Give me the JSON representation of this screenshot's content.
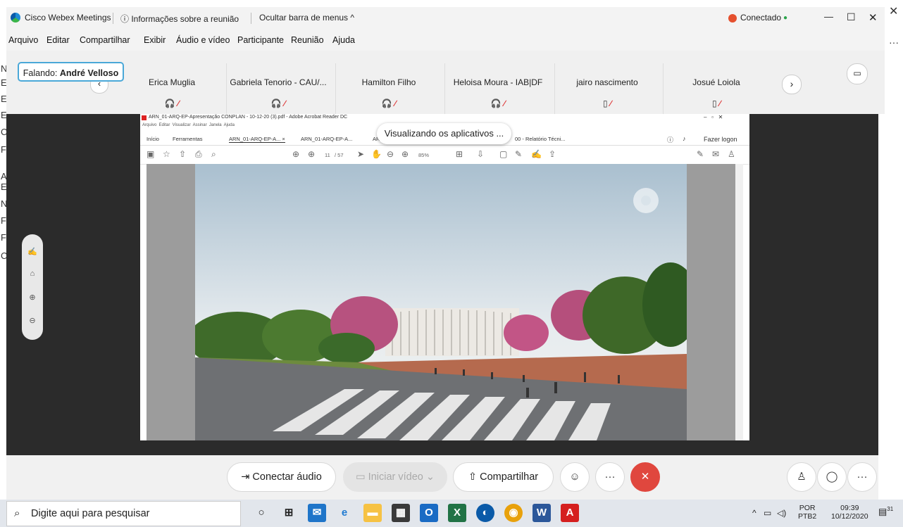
{
  "bg_letters": [
    "N",
    "E",
    "E",
    "E",
    "C",
    "F",
    "A",
    "E",
    "N",
    "F",
    "F",
    "C"
  ],
  "titlebar": {
    "app_name": "Cisco Webex Meetings",
    "meeting_info": "ⓘ Informações sobre a reunião",
    "hide_menu": "Ocultar barra de menus ^",
    "status": "Conectado",
    "status_dot": "●",
    "minimize": "—",
    "maximize": "☐",
    "close": "✕"
  },
  "menu": [
    "Arquivo",
    "Editar",
    "Compartilhar",
    "Exibir",
    "Áudio e vídeo",
    "Participante",
    "Reunião",
    "Ajuda"
  ],
  "speaking": {
    "prefix": "Falando:",
    "name": "André Velloso"
  },
  "participants": [
    {
      "name": "Erica Muglia",
      "device": "headset-icon"
    },
    {
      "name": "Gabriela Tenorio - CAU/...",
      "device": "headset-icon"
    },
    {
      "name": "Hamilton Filho",
      "device": "headset-icon"
    },
    {
      "name": "Heloisa Moura - IAB|DF",
      "device": "headset-icon"
    },
    {
      "name": "jairo nascimento",
      "device": "phone-icon"
    },
    {
      "name": "Josué Loiola",
      "device": "phone-icon"
    }
  ],
  "acrobat": {
    "title": "ARN_01-ARQ-EP-Apresentação CONPLAN - 10-12-20 (3).pdf - Adobe Acrobat Reader DC",
    "menu": "Arquivo  Editar  Visualizar  Assinar  Janela  Ajuda",
    "tabs": [
      "Início",
      "Ferramentas",
      "ARN_01-ARQ-EP-A...  ×",
      "ARN_01-ARQ-EP-A...",
      "AR",
      "00 - Relatório Técni..."
    ],
    "login": "Fazer logon",
    "page": "11",
    "page_total": "/ 57",
    "zoom": "85%",
    "win_controls": "–   ▫   ✕"
  },
  "viewing_banner": "Visualizando os aplicativos ...",
  "bottom": {
    "audio": "Conectar áudio",
    "video": "Iniciar vídeo",
    "share": "Compartilhar",
    "more": "···",
    "end": "✕"
  },
  "taskbar": {
    "search_placeholder": "Digite aqui para pesquisar",
    "lang_top": "POR",
    "lang_bottom": "PTB2",
    "time": "09:39",
    "date": "10/12/2020",
    "notifications": "31"
  }
}
